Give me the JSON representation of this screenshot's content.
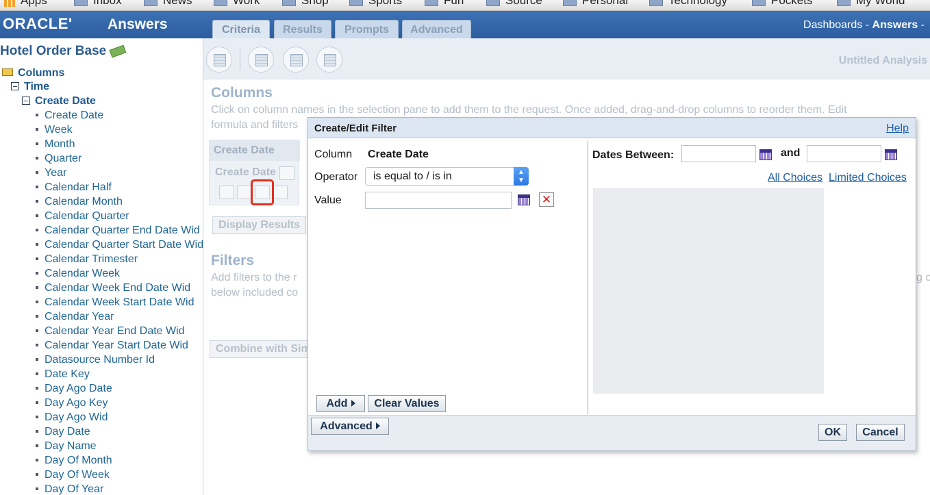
{
  "bookmarks": [
    "Apps",
    "Inbox",
    "News",
    "Work",
    "Shop",
    "Sports",
    "Fun",
    "Source",
    "Personal",
    "Technology",
    "Pockets",
    "My World"
  ],
  "brand": {
    "logo": "ORACLE'",
    "app_name": "Answers"
  },
  "subject_area": {
    "title": "Hotel Order Base"
  },
  "tree": {
    "root": "Columns",
    "folder": "Time",
    "subfolder": "Create Date",
    "items": [
      "Create Date",
      "Week",
      "Month",
      "Quarter",
      "Year",
      "Calendar Half",
      "Calendar Month",
      "Calendar Quarter",
      "Calendar Quarter End Date Wid",
      "Calendar Quarter Start Date Wid",
      "Calendar Trimester",
      "Calendar Week",
      "Calendar Week End Date Wid",
      "Calendar Week Start Date Wid",
      "Calendar Year",
      "Calendar Year End Date Wid",
      "Calendar Year Start Date Wid",
      "Datasource Number Id",
      "Date Key",
      "Day Ago Date",
      "Day Ago Key",
      "Day Ago Wid",
      "Day Date",
      "Day Name",
      "Day Of Month",
      "Day Of Week",
      "Day Of Year"
    ]
  },
  "tabs": [
    "Criteria",
    "Results",
    "Prompts",
    "Advanced"
  ],
  "topnav": {
    "dashboards": "Dashboards",
    "sep1": " - ",
    "answers": "Answers",
    "sep2": " -"
  },
  "toolbar": {
    "analysis_name": "Untitled Analysis"
  },
  "columns_section": {
    "title": "Columns",
    "line1": "Click on column names in the selection pane to add them to the request. Once added, drag-and-drop columns to reorder them. Edit",
    "line2": "formula and filters",
    "box_header": "Create Date",
    "box_label": "Create Date",
    "display_results": "Display Results"
  },
  "filters_section": {
    "title": "Filters",
    "line1": "Add filters to the r",
    "line2": "below included co",
    "right_fragment": "g o",
    "combine": "Combine with Sim"
  },
  "dialog": {
    "title": "Create/Edit Filter",
    "help": "Help",
    "column_label": "Column",
    "column_value": "Create Date",
    "operator_label": "Operator",
    "operator_value": "is equal to / is in",
    "value_label": "Value",
    "value_input": "",
    "dates_between_label": "Dates Between:",
    "and_label": "and",
    "date_from": "",
    "date_to": "",
    "all_choices": "All Choices",
    "limited_choices": "Limited Choices",
    "add_button": "Add",
    "clear_values_button": "Clear Values",
    "advanced_button": "Advanced",
    "ok_button": "OK",
    "cancel_button": "Cancel"
  }
}
